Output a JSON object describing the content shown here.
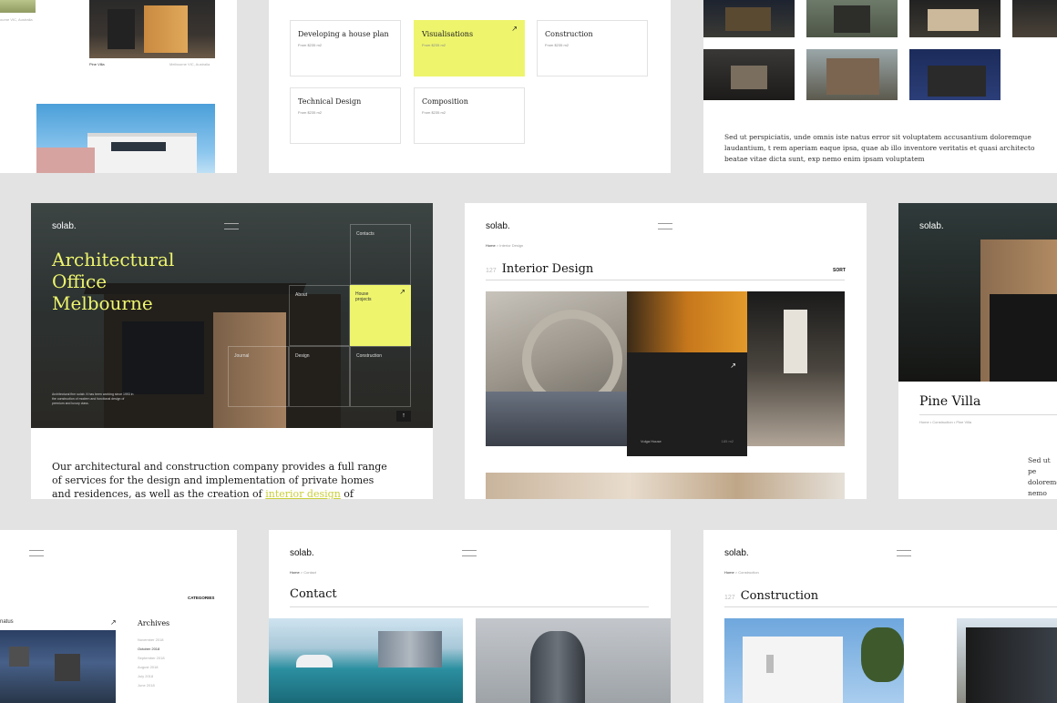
{
  "brand": "solab.",
  "top_left": {
    "caption_left": "Pine Villa",
    "caption_right": "Melbourne VIC, Australia",
    "partial_caption": "ourne VIC, Australia"
  },
  "services": {
    "items": [
      {
        "title": "Developing a house plan",
        "price": "From $235 m2"
      },
      {
        "title": "Visualisations",
        "price": "From $235 m2"
      },
      {
        "title": "Construction",
        "price": "From $235 m2"
      },
      {
        "title": "Technical Design",
        "price": "From $235 m2"
      },
      {
        "title": "Composition",
        "price": "From $235 m2"
      }
    ]
  },
  "gallery": {
    "text": "Sed ut perspiciatis, unde omnis iste natus error sit voluptatem accusantium doloremque laudantium, t rem aperiam eaque ipsa, quae ab illo inventore veritatis et quasi architecto beatae vitae dicta sunt, exp nemo enim ipsam voluptatem"
  },
  "hero": {
    "title_line1": "Architectural",
    "title_line2": "Office",
    "title_line3": "Melbourne",
    "nav": {
      "contacts": "Contacts",
      "about": "About",
      "house_projects": "House projects",
      "journal": "Journal",
      "design": "Design",
      "construction": "Construction"
    },
    "small_text": "Architectural firm solab. It has been working since 1993 in the construction of modern and functional design of premium and luxury class.",
    "intro_before": "Our architectural and construction company provides a full range of services for the design and implementation of private homes and residences, as well as the creation of ",
    "intro_link": "interior design",
    "intro_after": " of houses and"
  },
  "interior": {
    "breadcrumb_home": "Home",
    "breadcrumb_current": "Interior Design",
    "number": "127",
    "title": "Interior Design",
    "sort": "SORT",
    "tile_label": "Vulga House",
    "tile_size": "185 m2"
  },
  "pine_villa": {
    "title": "Pine Villa",
    "breadcrumb": "Home • Construction • Pine Villa",
    "text": "Sed ut pe doloremq nemo enim"
  },
  "blog": {
    "categories": "CATEGORIES",
    "post_label": "natus",
    "archives_title": "Archives",
    "archives": [
      "November 2018",
      "October 2018",
      "September 2018",
      "August 2018",
      "July 2018",
      "June 2018"
    ]
  },
  "contact": {
    "breadcrumb_home": "Home",
    "breadcrumb_current": "Contact",
    "title": "Contact"
  },
  "construction": {
    "breadcrumb_home": "Home",
    "breadcrumb_current": "Construction",
    "number": "127",
    "title": "Construction"
  },
  "colors": {
    "accent": "#eef56d",
    "link": "#c9cf3a",
    "background": "#e3e3e3",
    "dark": "#1e1e1e"
  }
}
